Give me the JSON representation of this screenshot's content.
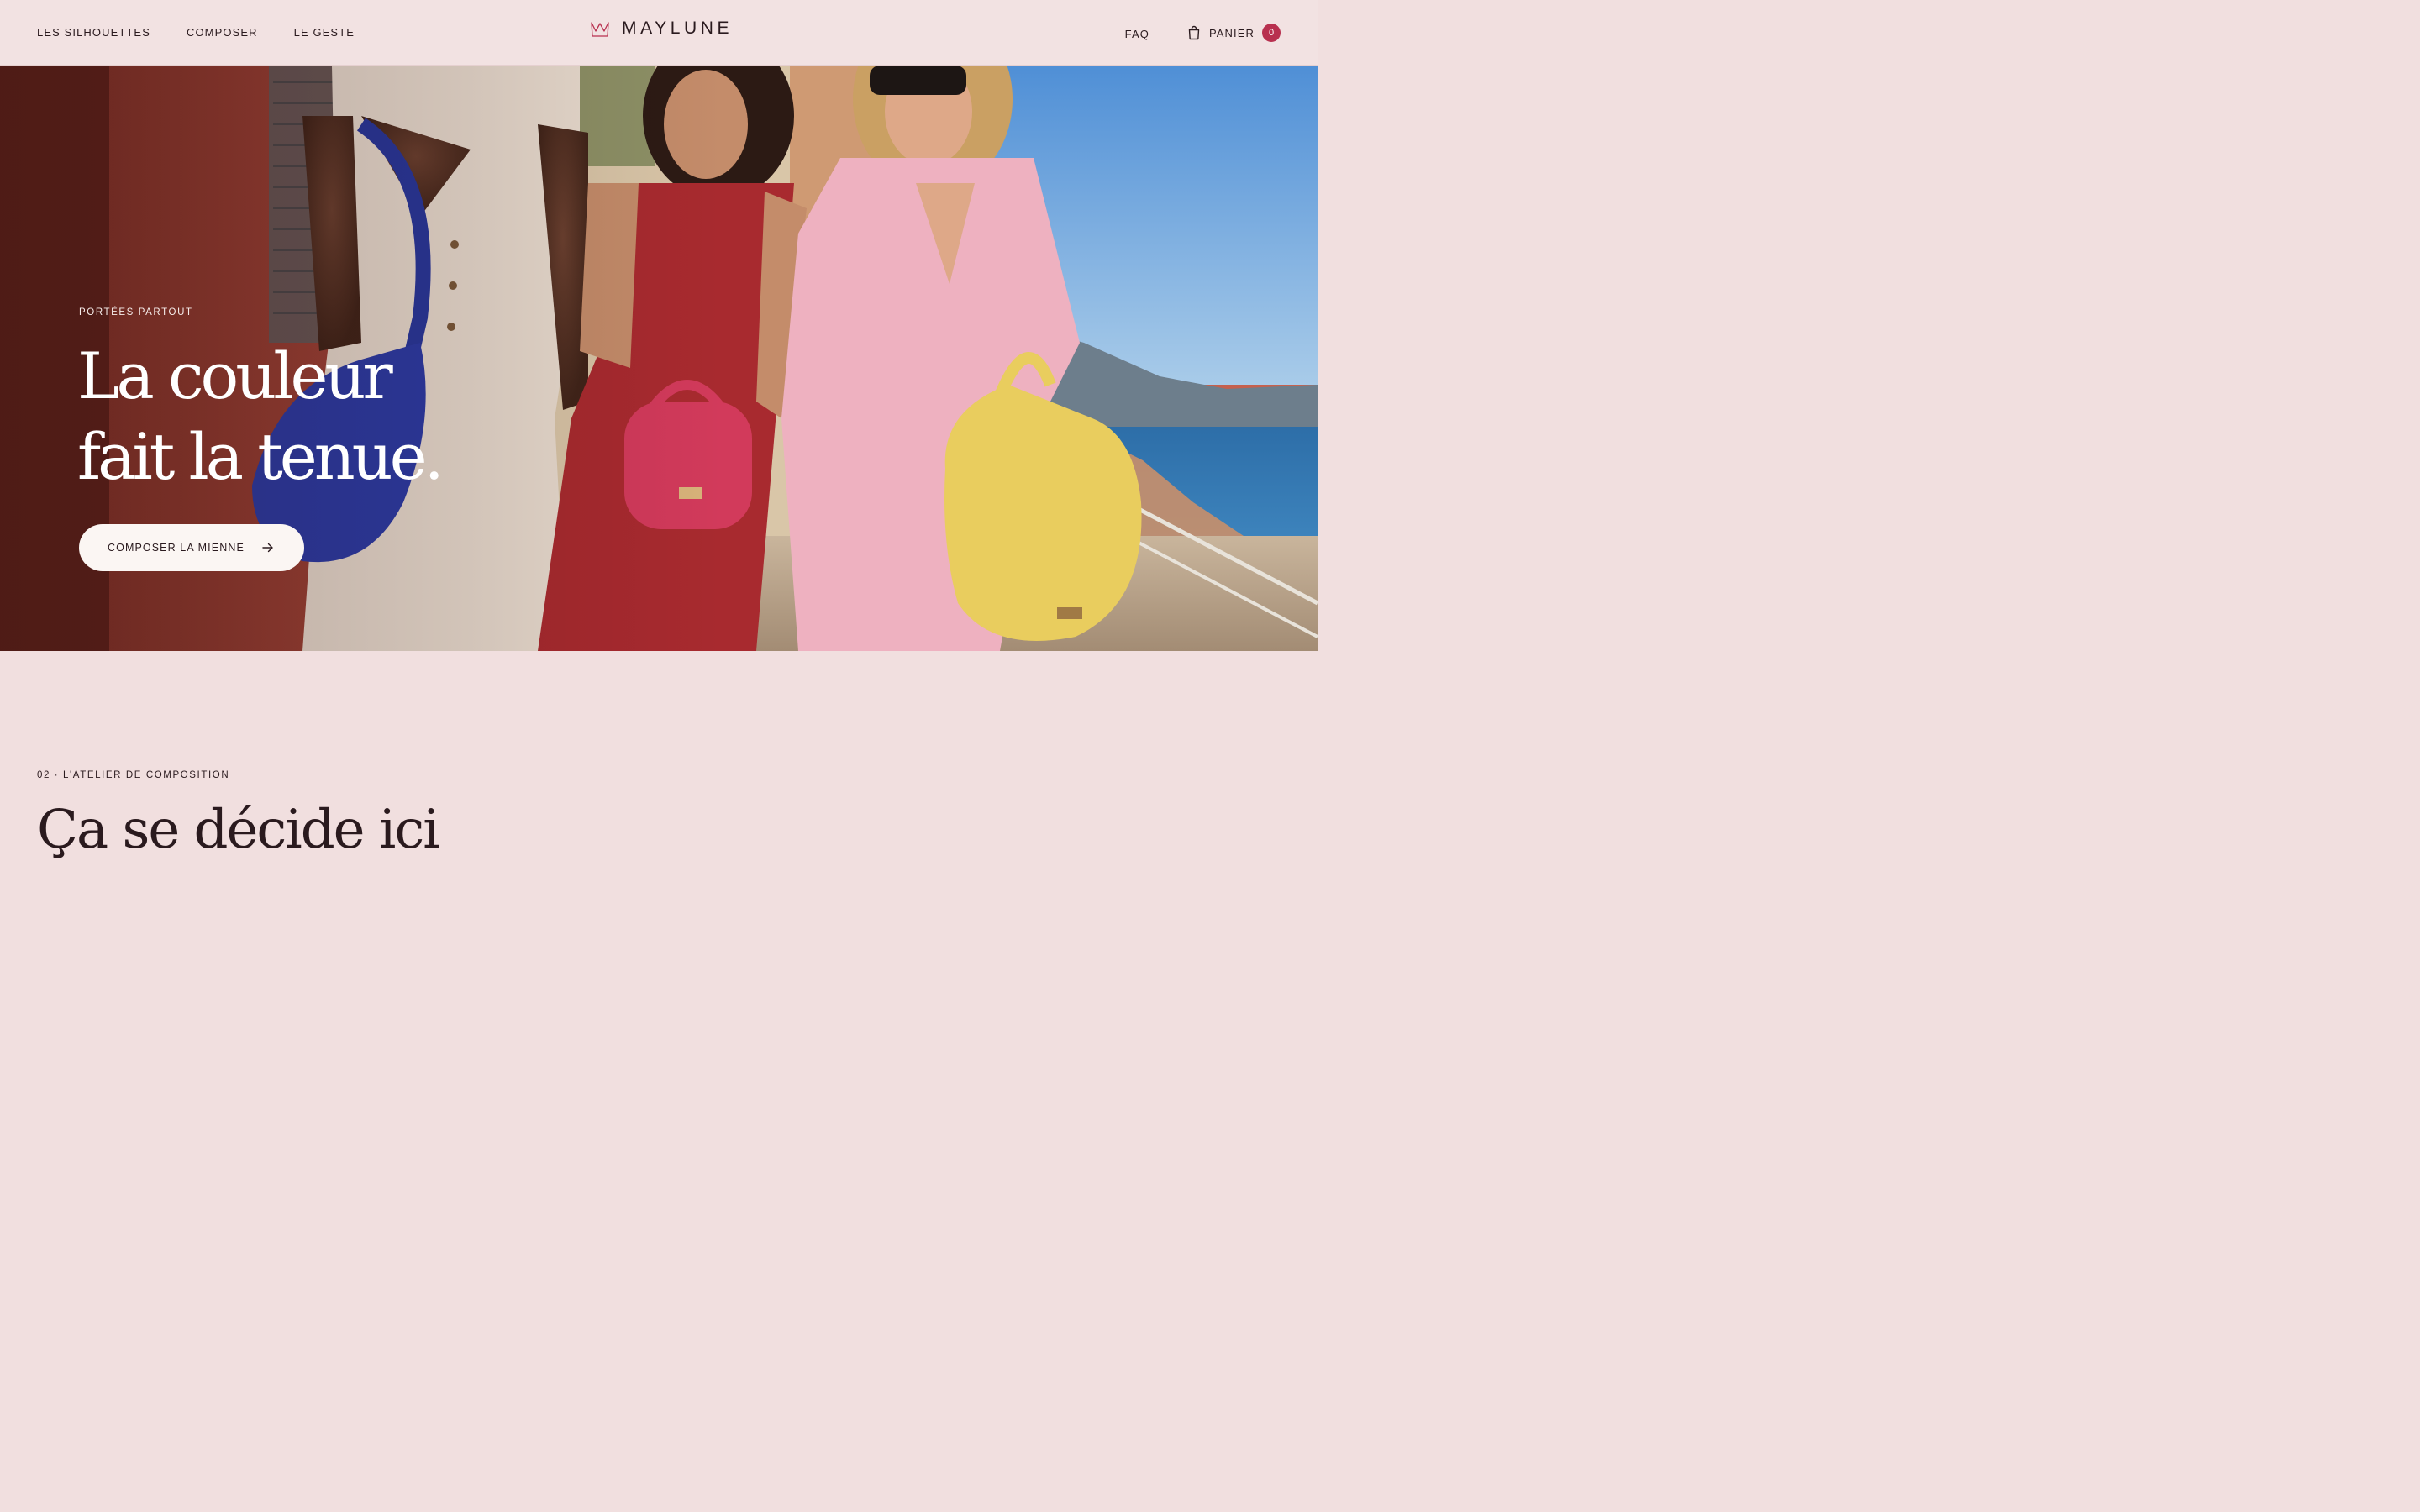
{
  "header": {
    "nav_left": [
      "LES SILHOUETTES",
      "COMPOSER",
      "LE GESTE"
    ],
    "brand": {
      "name": "MAYLUNE",
      "logo_icon": "crown-m-logo",
      "logo_color": "#b8304f"
    },
    "faq_label": "FAQ",
    "cart": {
      "icon": "shopping-bag-icon",
      "label": "PANIER",
      "count": "0",
      "badge_color": "#b8304f"
    }
  },
  "hero": {
    "eyebrow": "PORTÉES PARTOUT",
    "title_line1": "La couleur",
    "title_line2": "fait la tenue.",
    "cta_label": "COMPOSER LA MIENNE",
    "cta_icon": "arrow-right-icon",
    "image": "three women walking on a Riviera street carrying blue, red-pink and yellow crochet bags"
  },
  "section": {
    "eyebrow": "02 · L'ATELIER DE COMPOSITION",
    "title": "Ça se décide ici"
  },
  "colors": {
    "background": "#f1dfdf",
    "header_bg": "#f2e2e2",
    "text": "#2a1a1e",
    "accent": "#b8304f",
    "cta_bg": "#fbf6f3"
  }
}
